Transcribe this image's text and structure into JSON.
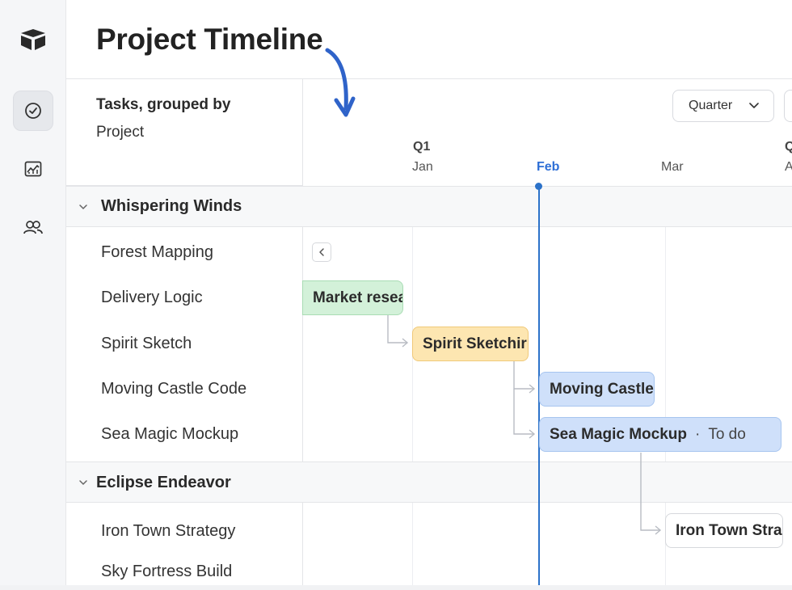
{
  "header": {
    "title": "Project Timeline"
  },
  "sidebar": {
    "items": [
      {
        "icon": "app-logo-icon",
        "active": false
      },
      {
        "icon": "check-circle-icon",
        "active": true
      },
      {
        "icon": "chart-icon",
        "active": false
      },
      {
        "icon": "users-icon",
        "active": false
      }
    ]
  },
  "grouping": {
    "line1": "Tasks, grouped by",
    "line2": "Project"
  },
  "controls": {
    "zoom_label": "Quarter"
  },
  "scale": {
    "quarters": [
      "Q1",
      "Q"
    ],
    "months": [
      "Jan",
      "Feb",
      "Mar",
      "A"
    ],
    "today_month": "Feb"
  },
  "groups": [
    {
      "name": "Whispering Winds",
      "tasks": [
        "Forest Mapping",
        "Delivery Logic",
        "Spirit Sketch",
        "Moving Castle Code",
        "Sea Magic Mockup"
      ]
    },
    {
      "name": "Eclipse Endeavor",
      "tasks": [
        "Iron Town Strategy",
        "Sky Fortress Build"
      ]
    }
  ],
  "bars": [
    {
      "label": "Market resea",
      "status": "",
      "color": "green"
    },
    {
      "label": "Spirit Sketchir",
      "status": "",
      "color": "yellow"
    },
    {
      "label": "Moving Castle",
      "status": "",
      "color": "blue"
    },
    {
      "label": "Sea Magic Mockup",
      "status": "To do",
      "color": "blue"
    },
    {
      "label": "Iron Town Stra",
      "status": "",
      "color": "white"
    }
  ],
  "colors": {
    "accent": "#2c72c9",
    "annotation_arrow": "#2f63c9"
  }
}
